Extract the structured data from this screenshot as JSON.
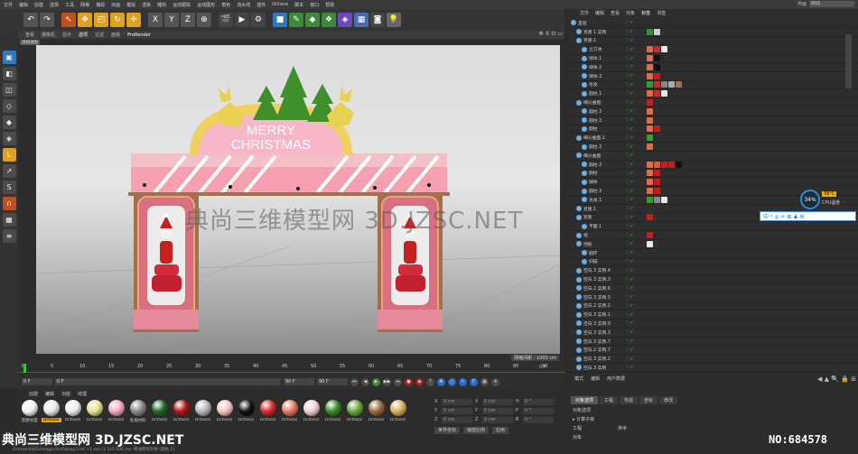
{
  "menu": [
    "文件",
    "编辑",
    "创建",
    "选择",
    "工具",
    "网格",
    "捕捉",
    "动画",
    "模拟",
    "渲染",
    "雕刻",
    "运动跟踪",
    "运动图形",
    "角色",
    "流水线",
    "插件",
    "Octane",
    "脚本",
    "窗口",
    "帮助"
  ],
  "layout": {
    "label": "界面",
    "value": "启动"
  },
  "viewport": {
    "menu": [
      "查看",
      "摄像机",
      "显示",
      "选项",
      "过滤",
      "面板",
      "ProRender"
    ],
    "label": "透视视图",
    "scene_distance": "网格间距 : 1000 cm",
    "icons": "✥ ⇕ ⊡ ▭"
  },
  "scene": {
    "sign_line1": "MERRY",
    "sign_line2": "CHRISTMAS"
  },
  "timeline": {
    "ticks": [
      "0",
      "5",
      "10",
      "15",
      "20",
      "25",
      "30",
      "35",
      "40",
      "45",
      "50",
      "55",
      "60",
      "65",
      "70",
      "75",
      "80",
      "85",
      "90"
    ],
    "end_label": "0 F",
    "start_frame": "0 F",
    "frame_a": "0 F",
    "frame_b": "90 F",
    "frame_c": "90 F",
    "transport": [
      "⏮",
      "◀",
      "▶",
      "▶▶",
      "⏭"
    ]
  },
  "materials": {
    "menu": [
      "创建",
      "编辑",
      "功能",
      "纹理"
    ],
    "items": [
      {
        "label": "雪碧纹理",
        "color": "#f2f2f2"
      },
      {
        "label": "OctGlos",
        "color": "#e8e8e8"
      },
      {
        "label": "OctGlos",
        "color": "#ececec"
      },
      {
        "label": "OctGlos",
        "color": "#e6e08a"
      },
      {
        "label": "OctGlos",
        "color": "#f2a8c0"
      },
      {
        "label": "毛发材料",
        "color": "#888888"
      },
      {
        "label": "OctGlos",
        "color": "#1f6a2a"
      },
      {
        "label": "OctGlos",
        "color": "#b01818"
      },
      {
        "label": "OctGlos",
        "color": "#b9b9b9"
      },
      {
        "label": "OctGlos",
        "color": "#f5c6c6"
      },
      {
        "label": "OctGlos",
        "color": "#111111"
      },
      {
        "label": "OctGlos",
        "color": "#d82a2a"
      },
      {
        "label": "OctGlos",
        "color": "#e87a60"
      },
      {
        "label": "OctGlos",
        "color": "#f0d0d0"
      },
      {
        "label": "OctGlos",
        "color": "#3a8a2a"
      },
      {
        "label": "OctGlos",
        "color": "#6aaa3a"
      },
      {
        "label": "OctGlos",
        "color": "#9a6a3a"
      },
      {
        "label": "OctGlos",
        "color": "#d8b060"
      }
    ]
  },
  "coords": {
    "rows": [
      {
        "a": "X",
        "av": "0 cm",
        "b": "X",
        "bv": "0 cm",
        "c": "H",
        "cv": "0 °"
      },
      {
        "a": "Y",
        "av": "0 cm",
        "b": "Y",
        "bv": "0 cm",
        "c": "P",
        "cv": "0 °"
      },
      {
        "a": "Z",
        "av": "0 cm",
        "b": "Z",
        "bv": "0 cm",
        "c": "B",
        "cv": "0 °"
      }
    ],
    "mode": "世界坐标",
    "scale": "缩放比例",
    "apply": "应用"
  },
  "objects": {
    "menu": [
      "文件",
      "编辑",
      "查看",
      "对象",
      "标签",
      "书签"
    ],
    "rows": [
      {
        "name": "圣诞",
        "indent": 4,
        "tags": []
      },
      {
        "name": "克隆 1 实例",
        "indent": 10,
        "tags": [
          "#3a8a3a",
          "#d0d0d0"
        ]
      },
      {
        "name": "克隆.1",
        "indent": 10,
        "tags": []
      },
      {
        "name": "立方体",
        "indent": 16,
        "tags": [
          "#d87050",
          "#c03030",
          "#e8e8e8"
        ]
      },
      {
        "name": "球体.1",
        "indent": 16,
        "tags": [
          "#d87050",
          "#111111"
        ]
      },
      {
        "name": "球体.2",
        "indent": 16,
        "tags": [
          "#d87050",
          "#111111"
        ]
      },
      {
        "name": "球体.3",
        "indent": 16,
        "tags": [
          "#d87050",
          "#c02020"
        ]
      },
      {
        "name": "毛发",
        "indent": 16,
        "tags": [
          "#3a9a3a",
          "#c03030",
          "#888888",
          "#aaaaaa",
          "#a07050"
        ]
      },
      {
        "name": "圆柱.1",
        "indent": 16,
        "tags": [
          "#d87050",
          "#c03030",
          "#e8e8e8"
        ]
      },
      {
        "name": "细分曲面",
        "indent": 10,
        "tags": [
          "#c02020"
        ]
      },
      {
        "name": "圆柱.3",
        "indent": 16,
        "tags": [
          "#d87050"
        ]
      },
      {
        "name": "圆柱.2",
        "indent": 16,
        "tags": [
          "#d87050"
        ]
      },
      {
        "name": "圆柱",
        "indent": 16,
        "tags": [
          "#d87050",
          "#c02020"
        ]
      },
      {
        "name": "细分曲面.2",
        "indent": 10,
        "tags": [
          "#3a9a3a"
        ]
      },
      {
        "name": "圆柱.3",
        "indent": 16,
        "tags": [
          "#d87050"
        ]
      },
      {
        "name": "细分曲面",
        "indent": 10,
        "tags": []
      },
      {
        "name": "圆柱.3",
        "indent": 16,
        "tags": [
          "#d87050",
          "#d86030",
          "#c02020",
          "#c02020",
          "#111111"
        ]
      },
      {
        "name": "圆柱",
        "indent": 16,
        "tags": [
          "#d87050",
          "#c02020"
        ]
      },
      {
        "name": "球体",
        "indent": 16,
        "tags": [
          "#d87050",
          "#c02020"
        ]
      },
      {
        "name": "圆柱.3",
        "indent": 16,
        "tags": [
          "#d87050",
          "#c02020"
        ]
      },
      {
        "name": "毛发.1",
        "indent": 16,
        "tags": [
          "#3a9a3a",
          "#888888",
          "#e8e8e8"
        ]
      },
      {
        "name": "克隆.1",
        "indent": 10,
        "tags": []
      },
      {
        "name": "克隆",
        "indent": 10,
        "tags": [
          "#c02020"
        ]
      },
      {
        "name": "平面.1",
        "indent": 16,
        "tags": []
      },
      {
        "name": "组",
        "indent": 10,
        "tags": [
          "#c02020"
        ]
      },
      {
        "name": "挡板",
        "indent": 10,
        "tags": [
          "#e8e8e8"
        ]
      },
      {
        "name": "圆环",
        "indent": 16,
        "tags": []
      },
      {
        "name": "扫描",
        "indent": 16,
        "tags": []
      },
      {
        "name": "空白.3 实例.4",
        "indent": 10,
        "tags": []
      },
      {
        "name": "空白.3 实例.3",
        "indent": 10,
        "tags": []
      },
      {
        "name": "空白.2 实例.6",
        "indent": 10,
        "tags": []
      },
      {
        "name": "空白.3 实例.5",
        "indent": 10,
        "tags": []
      },
      {
        "name": "空白.2 实例.2",
        "indent": 10,
        "tags": []
      },
      {
        "name": "空白.3 实例.1",
        "indent": 10,
        "tags": []
      },
      {
        "name": "空白.3 实例.9",
        "indent": 10,
        "tags": []
      },
      {
        "name": "空白.3 实例.3",
        "indent": 10,
        "tags": []
      },
      {
        "name": "空白.3 实例.7",
        "indent": 10,
        "tags": []
      },
      {
        "name": "空白.2 实例.7",
        "indent": 10,
        "tags": []
      },
      {
        "name": "空白.3 实例.2",
        "indent": 10,
        "tags": []
      },
      {
        "name": "空白.3 实例",
        "indent": 10,
        "tags": []
      }
    ]
  },
  "attributes": {
    "menu": [
      "模式",
      "编辑",
      "用户数据"
    ],
    "tabs": [
      "对象选项",
      "工程",
      "构造",
      "坐标",
      "修改"
    ],
    "line1": "对象选项",
    "line2": "▸ 计算子级",
    "project": "工程",
    "order": "排序",
    "objects": "对象"
  },
  "cpu": {
    "percent": "34%",
    "temp": "39°C",
    "label": "CPU温度"
  },
  "ime": "中 ⁿ ◎ ✂ ⊞ ♟ ⚙",
  "watermarks": {
    "center": "典尚三维模型网 3D.JZSC.NET",
    "bottom_left": "典尚三维模型网 3D.JZSC.NET",
    "number": "NO:684578"
  },
  "status": "Octane:InitGLImage:OctGlossy.3  loC~1 res=1  147.926 ms.      移动所有对象 [圆柱.2]"
}
